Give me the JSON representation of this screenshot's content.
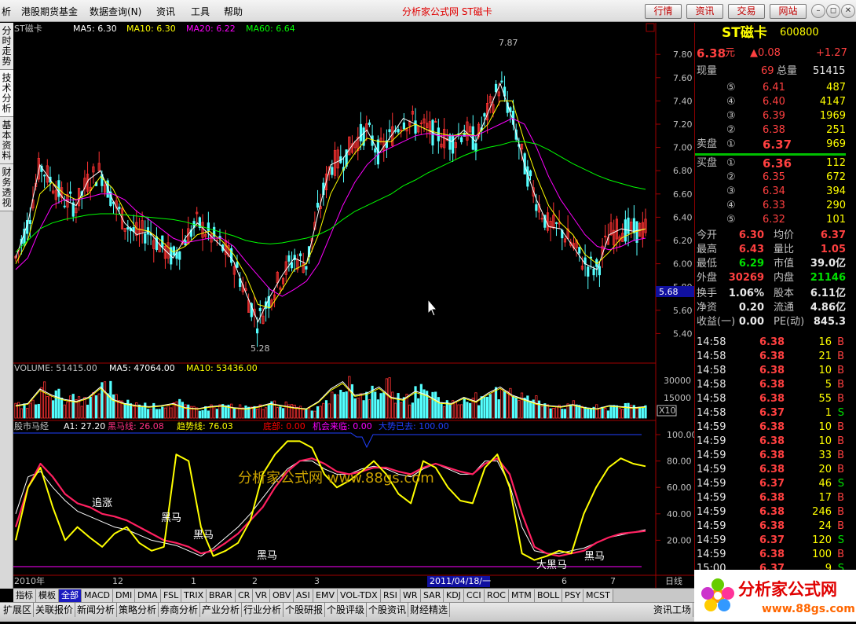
{
  "menu": [
    "析",
    "港股期货基金",
    "数据查询(N)",
    "资讯",
    "工具",
    "帮助"
  ],
  "title": "分析家公式网 ST磁卡",
  "top_buttons": [
    "行情",
    "资讯",
    "交易",
    "网站"
  ],
  "side_tabs": [
    "分时走势",
    "技术分析",
    "基本资料",
    "财务透视"
  ],
  "price_panel": {
    "stock": "ST磁卡",
    "ma5": "MA5: 6.30",
    "ma10": "MA10: 6.30",
    "ma20": "MA20: 6.22",
    "ma60": "MA60: 6.64",
    "yticks": [
      "7.80",
      "7.60",
      "7.40",
      "7.20",
      "7.00",
      "6.80",
      "6.60",
      "6.40",
      "6.20",
      "6.00",
      "5.80",
      "5.60",
      "5.40"
    ],
    "high_label": "7.87",
    "low_label": "5.28",
    "cursor_price": "5.68",
    "ymin": 5.2,
    "ymax": 7.95
  },
  "volume_panel": {
    "volume": "VOLUME: 51415.00",
    "ma5": "MA5: 47064.00",
    "ma10": "MA10: 53436.00",
    "yticks": [
      "30000",
      "15000"
    ],
    "unit": "X10",
    "ymax": 40000
  },
  "indicator_panel": {
    "name": "股市马经",
    "a1": "A1: 27.20",
    "heima": "黑马线: 26.08",
    "qushi": "趋势线: 76.03",
    "dibu": "底部: 0.00",
    "jihui": "机会来临: 0.00",
    "dashi": "大势已去: 100.00",
    "yticks": [
      "100.00",
      "80.00",
      "60.00",
      "40.00",
      "20.00"
    ],
    "watermark": "分析家公式网 www.88gs.com",
    "annotations": [
      "追涨",
      "黑马",
      "黑马",
      "黑马",
      "大黑马",
      "黑马"
    ]
  },
  "xaxis": {
    "labels": [
      "2010年",
      "12",
      "1",
      "2",
      "3",
      "2011/04/18/一",
      "6",
      "7"
    ],
    "period": "日线"
  },
  "chart_data": {
    "type": "line",
    "series": [
      {
        "name": "MA5",
        "values": [
          6.05,
          6.35,
          6.85,
          6.7,
          6.55,
          6.5,
          6.72,
          6.8,
          6.55,
          6.35,
          6.25,
          6.28,
          6.15,
          6.05,
          6.22,
          6.35,
          6.25,
          6.15,
          6.02,
          5.75,
          5.5,
          5.72,
          5.9,
          6.05,
          6.0,
          6.45,
          6.85,
          6.9,
          7.05,
          7.15,
          6.95,
          7.1,
          7.25,
          7.2,
          7.15,
          7.1,
          7.05,
          7.15,
          7.05,
          7.3,
          7.55,
          7.25,
          6.85,
          6.55,
          6.32,
          6.3,
          6.15,
          6.0,
          5.95,
          6.25,
          6.3,
          6.28,
          6.3
        ]
      },
      {
        "name": "MA10",
        "values": [
          6.0,
          6.2,
          6.6,
          6.7,
          6.6,
          6.55,
          6.6,
          6.75,
          6.65,
          6.45,
          6.3,
          6.28,
          6.2,
          6.1,
          6.15,
          6.25,
          6.28,
          6.2,
          6.08,
          5.9,
          5.65,
          5.62,
          5.78,
          5.95,
          6.0,
          6.25,
          6.6,
          6.8,
          6.95,
          7.08,
          7.05,
          7.05,
          7.15,
          7.2,
          7.15,
          7.12,
          7.1,
          7.12,
          7.1,
          7.2,
          7.4,
          7.4,
          7.05,
          6.75,
          6.5,
          6.35,
          6.25,
          6.08,
          6.0,
          6.1,
          6.22,
          6.27,
          6.3
        ]
      },
      {
        "name": "MA20",
        "values": [
          5.95,
          6.05,
          6.3,
          6.5,
          6.55,
          6.55,
          6.57,
          6.6,
          6.6,
          6.55,
          6.45,
          6.38,
          6.3,
          6.22,
          6.18,
          6.2,
          6.22,
          6.22,
          6.15,
          6.02,
          5.9,
          5.78,
          5.72,
          5.78,
          5.85,
          6.0,
          6.25,
          6.5,
          6.7,
          6.85,
          6.95,
          7.0,
          7.05,
          7.1,
          7.12,
          7.1,
          7.1,
          7.1,
          7.1,
          7.15,
          7.2,
          7.25,
          7.2,
          7.0,
          6.75,
          6.55,
          6.4,
          6.25,
          6.15,
          6.12,
          6.15,
          6.2,
          6.22
        ]
      },
      {
        "name": "MA60",
        "values": [
          6.1,
          6.2,
          6.3,
          6.35,
          6.38,
          6.4,
          6.42,
          6.43,
          6.43,
          6.42,
          6.41,
          6.4,
          6.39,
          6.38,
          6.36,
          6.33,
          6.3,
          6.27,
          6.24,
          6.2,
          6.18,
          6.17,
          6.18,
          6.2,
          6.22,
          6.25,
          6.3,
          6.38,
          6.45,
          6.5,
          6.55,
          6.6,
          6.67,
          6.72,
          6.78,
          6.83,
          6.88,
          6.93,
          6.97,
          7.0,
          7.02,
          7.05,
          7.05,
          7.03,
          6.98,
          6.92,
          6.86,
          6.81,
          6.76,
          6.72,
          6.69,
          6.66,
          6.64
        ]
      }
    ],
    "volume": [
      12,
      14,
      28,
      22,
      18,
      16,
      20,
      30,
      18,
      14,
      12,
      11,
      12,
      14,
      10,
      9,
      11,
      12,
      10,
      9,
      11,
      14,
      12,
      10,
      9,
      16,
      28,
      35,
      22,
      24,
      30,
      20,
      18,
      26,
      22,
      15,
      14,
      20,
      16,
      24,
      30,
      22,
      18,
      14,
      12,
      11,
      13,
      10,
      9,
      12,
      11,
      10,
      11
    ],
    "indicator": {
      "yellow": [
        20,
        60,
        75,
        45,
        20,
        30,
        22,
        15,
        25,
        30,
        18,
        12,
        15,
        85,
        80,
        30,
        8,
        12,
        18,
        35,
        70,
        85,
        95,
        95,
        90,
        70,
        60,
        65,
        72,
        80,
        70,
        55,
        48,
        80,
        75,
        60,
        50,
        48,
        75,
        85,
        60,
        10,
        5,
        8,
        12,
        10,
        40,
        60,
        75,
        82,
        78,
        76
      ],
      "red": [
        30,
        60,
        78,
        68,
        55,
        48,
        45,
        40,
        38,
        35,
        30,
        25,
        20,
        18,
        15,
        10,
        12,
        18,
        25,
        35,
        45,
        60,
        72,
        80,
        82,
        78,
        72,
        70,
        72,
        75,
        75,
        72,
        70,
        75,
        78,
        75,
        72,
        70,
        78,
        82,
        70,
        40,
        15,
        10,
        8,
        10,
        12,
        18,
        22,
        25,
        26,
        27
      ],
      "white": [
        40,
        68,
        72,
        60,
        50,
        42,
        38,
        34,
        30,
        28,
        24,
        20,
        18,
        16,
        12,
        8,
        14,
        22,
        30,
        40,
        52,
        64,
        74,
        80,
        80,
        74,
        70,
        70,
        74,
        76,
        74,
        70,
        68,
        74,
        78,
        74,
        70,
        70,
        80,
        80,
        62,
        30,
        12,
        10,
        10,
        12,
        14,
        18,
        22,
        24,
        26,
        28
      ]
    },
    "ylim": [
      5.2,
      7.95
    ]
  },
  "quote": {
    "name": "ST磁卡",
    "code": "600800",
    "price": "6.38",
    "unit": "元",
    "change": "▲0.08",
    "pct": "+1.27",
    "xianliang_lbl": "现量",
    "xianliang": "69",
    "zongliang_lbl": "总量",
    "zongliang": "51415",
    "sell": [
      [
        "⑤",
        "6.41",
        "487"
      ],
      [
        "④",
        "6.40",
        "4147"
      ],
      [
        "③",
        "6.39",
        "1969"
      ],
      [
        "②",
        "6.38",
        "251"
      ],
      [
        "①",
        "6.37",
        "969"
      ]
    ],
    "sell_lbl": "卖盘",
    "buy_lbl": "买盘",
    "buy": [
      [
        "①",
        "6.36",
        "112"
      ],
      [
        "②",
        "6.35",
        "672"
      ],
      [
        "③",
        "6.34",
        "394"
      ],
      [
        "④",
        "6.33",
        "290"
      ],
      [
        "⑤",
        "6.32",
        "101"
      ]
    ],
    "stats": [
      [
        "今开",
        "6.30",
        "均价",
        "6.37"
      ],
      [
        "最高",
        "6.43",
        "量比",
        "1.05"
      ],
      [
        "最低",
        "6.29",
        "市值",
        "39.0亿"
      ],
      [
        "外盘",
        "30269",
        "内盘",
        "21146"
      ],
      [
        "换手",
        "1.06%",
        "股本",
        "6.11亿"
      ],
      [
        "净资",
        "0.20",
        "流通",
        "4.86亿"
      ],
      [
        "收益(一)",
        "0.00",
        "PE(动)",
        "845.3"
      ]
    ],
    "ticks": [
      [
        "14:58",
        "6.38",
        "16",
        "B"
      ],
      [
        "14:58",
        "6.38",
        "21",
        "B"
      ],
      [
        "14:58",
        "6.38",
        "10",
        "B"
      ],
      [
        "14:58",
        "6.38",
        "5",
        "B"
      ],
      [
        "14:58",
        "6.38",
        "55",
        "B"
      ],
      [
        "14:58",
        "6.37",
        "1",
        "S"
      ],
      [
        "14:59",
        "6.38",
        "10",
        "B"
      ],
      [
        "14:59",
        "6.38",
        "10",
        "B"
      ],
      [
        "14:59",
        "6.38",
        "33",
        "B"
      ],
      [
        "14:59",
        "6.38",
        "20",
        "B"
      ],
      [
        "14:59",
        "6.37",
        "46",
        "S"
      ],
      [
        "14:59",
        "6.38",
        "17",
        "B"
      ],
      [
        "14:59",
        "6.38",
        "246",
        "B"
      ],
      [
        "14:59",
        "6.38",
        "24",
        "B"
      ],
      [
        "14:59",
        "6.37",
        "120",
        "S"
      ],
      [
        "14:59",
        "6.38",
        "100",
        "B"
      ],
      [
        "15:00",
        "6.37",
        "9",
        "S"
      ]
    ]
  },
  "indicator_tabs": [
    "指标",
    "模板",
    "全部",
    "MACD",
    "DMI",
    "DMA",
    "FSL",
    "TRIX",
    "BRAR",
    "CR",
    "VR",
    "OBV",
    "ASI",
    "EMV",
    "VOL-TDX",
    "RSI",
    "WR",
    "SAR",
    "KDJ",
    "CCI",
    "ROC",
    "MTM",
    "BOLL",
    "PSY",
    "MCST"
  ],
  "status_tabs": [
    "扩展区",
    "关联报价",
    "新闻分析",
    "策略分析",
    "券商分析",
    "产业分析",
    "行业分析",
    "个股研报",
    "个股评级",
    "个股资讯",
    "财经精选"
  ],
  "status_right": "资讯工场",
  "logo": {
    "text": "分析家公式网",
    "url": "www.88gs.com"
  },
  "colors": {
    "ma5": "#ffffff",
    "ma10": "#ffff00",
    "ma20": "#ff00ff",
    "ma60": "#00ff00",
    "up": "#ff3232",
    "down": "#54ffff"
  }
}
